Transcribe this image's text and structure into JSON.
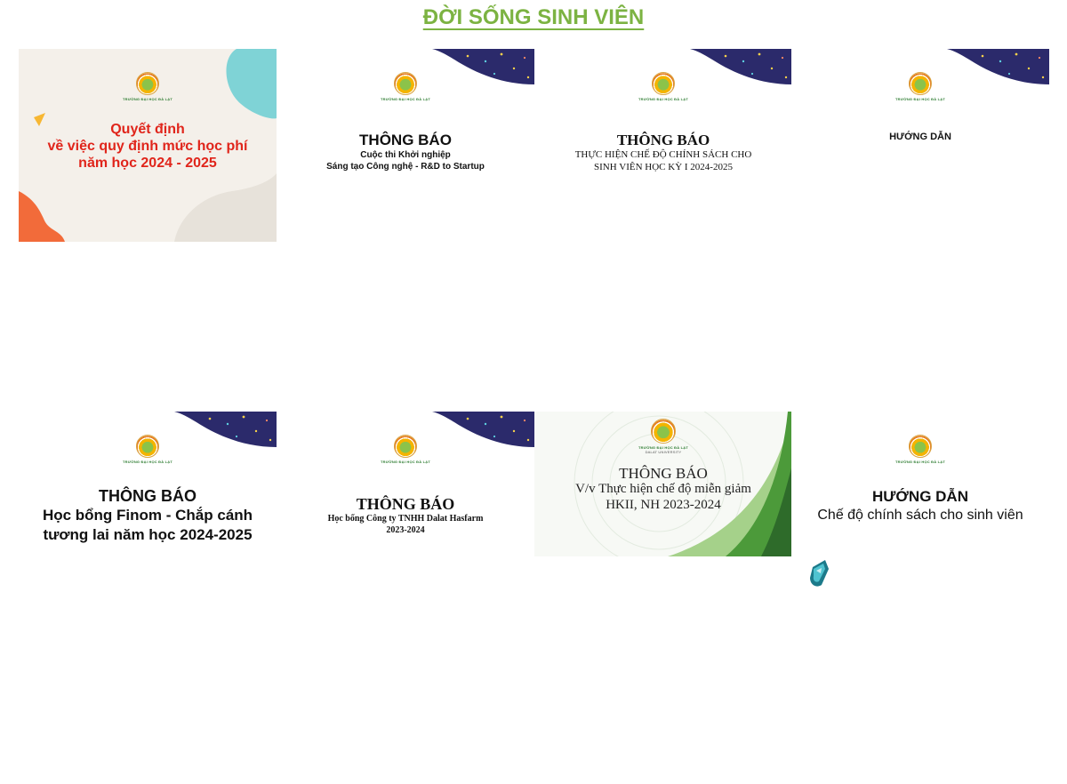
{
  "section": {
    "title": "ĐỜI SỐNG SINH VIÊN"
  },
  "logo_caption": "TRƯỜNG ĐẠI HỌC ĐÀ LẠT",
  "logo_caption_alt": "TRƯỜNG ĐẠI HỌC ĐÀ LẠT",
  "logo_caption_sub": "DALAT UNIVERSITY",
  "colors": {
    "title_green": "#7cb342",
    "red_text": "#e0251b",
    "navy": "#2b2a6b",
    "teal": "#7fd3d6",
    "orange": "#f26b3a"
  },
  "cards": [
    {
      "line1": "Quyết định",
      "line2": "về việc quy định mức học phí",
      "line3": "năm học 2024 - 2025"
    },
    {
      "heading": "THÔNG BÁO",
      "line1": "Cuộc thi Khởi nghiệp",
      "line2": "Sáng tạo Công nghệ - R&D to Startup"
    },
    {
      "heading": "THÔNG BÁO",
      "line1": "THỰC HIỆN CHẾ ĐỘ CHÍNH SÁCH CHO",
      "line2": "SINH VIÊN HỌC KỲ I 2024-2025"
    },
    {
      "heading": "HƯỚNG DẪN"
    },
    {
      "heading": "THÔNG BÁO",
      "line1": "Học bổng Finom - Chắp cánh",
      "line2": "tương lai năm học 2024-2025"
    },
    {
      "heading": "THÔNG BÁO",
      "line1": "Học bổng Công ty TNHH Dalat Hasfarm",
      "line2": "2023-2024"
    },
    {
      "heading": "THÔNG BÁO",
      "line1": "V/v Thực hiện chế độ miễn giảm",
      "line2": "HKII, NH 2023-2024"
    },
    {
      "heading": "HƯỚNG DẪN",
      "line1": "Chế độ chính sách cho sinh viên"
    }
  ]
}
